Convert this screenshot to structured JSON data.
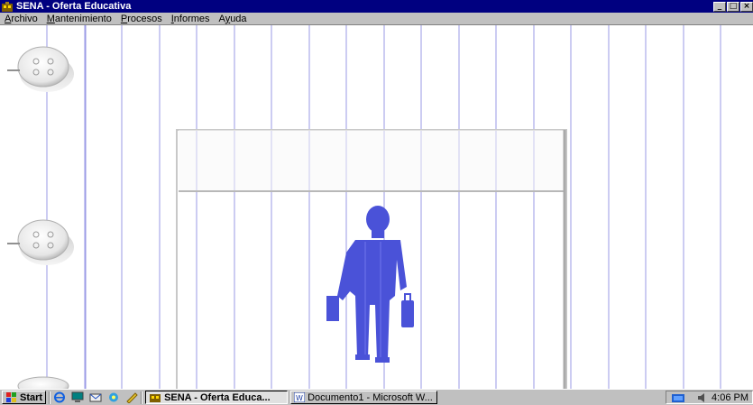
{
  "window": {
    "title": "SENA - Oferta Educativa",
    "controls": {
      "minimize": "_",
      "maximize": "□",
      "close": "×"
    }
  },
  "menu": [
    {
      "id": "archivo",
      "label": "Archivo",
      "hotkey": "A",
      "rest": "rchivo"
    },
    {
      "id": "mantenimiento",
      "label": "Mantenimiento",
      "hotkey": "M",
      "rest": "antenimiento"
    },
    {
      "id": "procesos",
      "label": "Procesos",
      "hotkey": "P",
      "rest": "rocesos"
    },
    {
      "id": "informes",
      "label": "Informes",
      "hotkey": "I",
      "rest": "nformes"
    },
    {
      "id": "ayuda",
      "label": "Ayuda",
      "pre": "A",
      "hotkey": "y",
      "rest": "uda"
    }
  ],
  "taskbar": {
    "start_label": "Start",
    "quick_launch": [
      "internet-explorer-icon",
      "desktop-icon",
      "outlook-icon",
      "channels-icon",
      "pen-icon"
    ],
    "tasks": [
      {
        "id": "sena",
        "label": "SENA - Oferta Educa...",
        "active": true
      },
      {
        "id": "word",
        "label": "Documento1 - Microsoft W...",
        "active": false
      }
    ],
    "clock": "4:06 PM"
  },
  "colors": {
    "titlebar": "#000080",
    "chrome": "#c0c0c0",
    "paper_lines": "#9a9ae6",
    "figure": "#4a52d8"
  }
}
